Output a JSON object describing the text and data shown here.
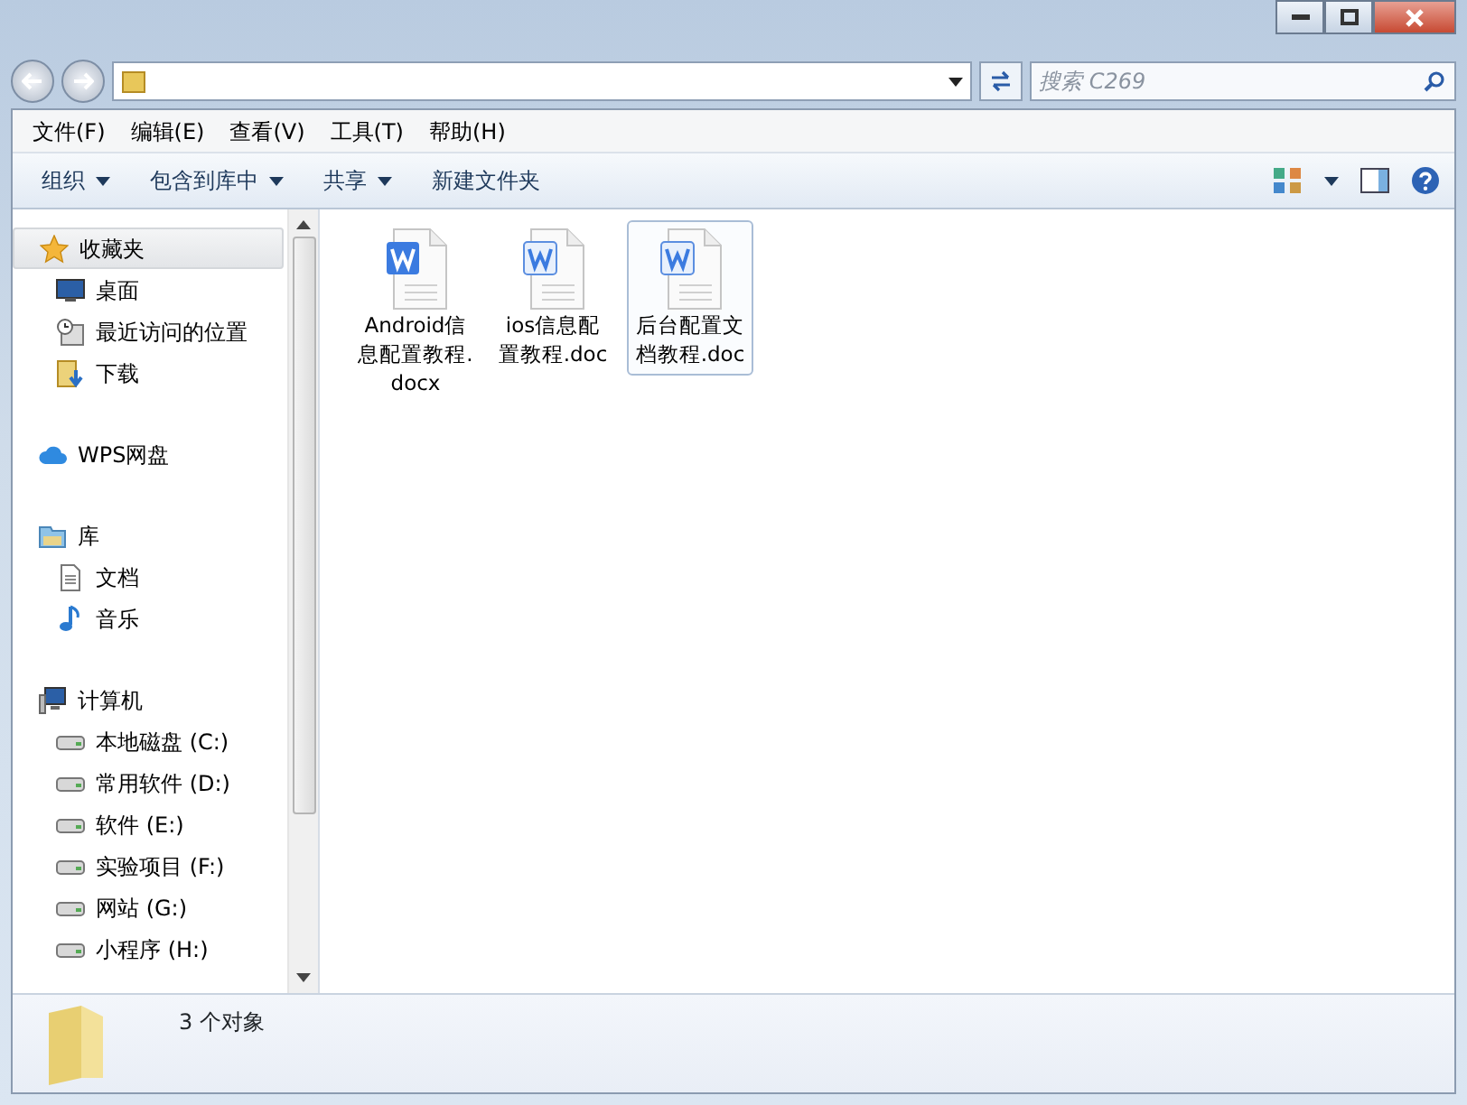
{
  "address_bar": {
    "search": {
      "placeholder": "搜索 C269"
    }
  },
  "menu_bar": [
    "文件(F)",
    "编辑(E)",
    "查看(V)",
    "工具(T)",
    "帮助(H)"
  ],
  "toolbar": [
    {
      "label": "组织",
      "dropdown": true
    },
    {
      "label": "包含到库中",
      "dropdown": true
    },
    {
      "label": "共享",
      "dropdown": true
    },
    {
      "label": "新建文件夹",
      "dropdown": false
    }
  ],
  "sidebar": {
    "groups": [
      {
        "label": "收藏夹",
        "kind": "star",
        "selected": true,
        "children": [
          {
            "label": "桌面",
            "kind": "desktop",
            "selected": false
          },
          {
            "label": "最近访问的位置",
            "kind": "recent",
            "selected": false
          },
          {
            "label": "下载",
            "kind": "download",
            "selected": false
          }
        ]
      },
      {
        "label": "WPS网盘",
        "kind": "cloud",
        "selected": false
      },
      {
        "label": "库",
        "kind": "library",
        "selected": false,
        "children": [
          {
            "label": "文档",
            "kind": "document",
            "selected": false
          },
          {
            "label": "音乐",
            "kind": "music",
            "selected": false
          }
        ]
      },
      {
        "label": "计算机",
        "kind": "computer",
        "selected": false,
        "children": [
          {
            "label": "本地磁盘 (C:)",
            "kind": "drive",
            "selected": false
          },
          {
            "label": "常用软件 (D:)",
            "kind": "drive",
            "selected": false
          },
          {
            "label": "软件 (E:)",
            "kind": "drive",
            "selected": false
          },
          {
            "label": "实验项目 (F:)",
            "kind": "drive",
            "selected": false
          },
          {
            "label": "网站 (G:)",
            "kind": "drive",
            "selected": false
          },
          {
            "label": "小程序 (H:)",
            "kind": "drive",
            "selected": false
          }
        ]
      }
    ]
  },
  "files": [
    {
      "name": "Android信息配置教程.docx",
      "kind": "docx",
      "selected": false
    },
    {
      "name": "ios信息配置教程.doc",
      "kind": "doc",
      "selected": false
    },
    {
      "name": "后台配置文档教程.doc",
      "kind": "doc",
      "selected": true
    }
  ],
  "status_bar": {
    "text": "3 个对象"
  }
}
